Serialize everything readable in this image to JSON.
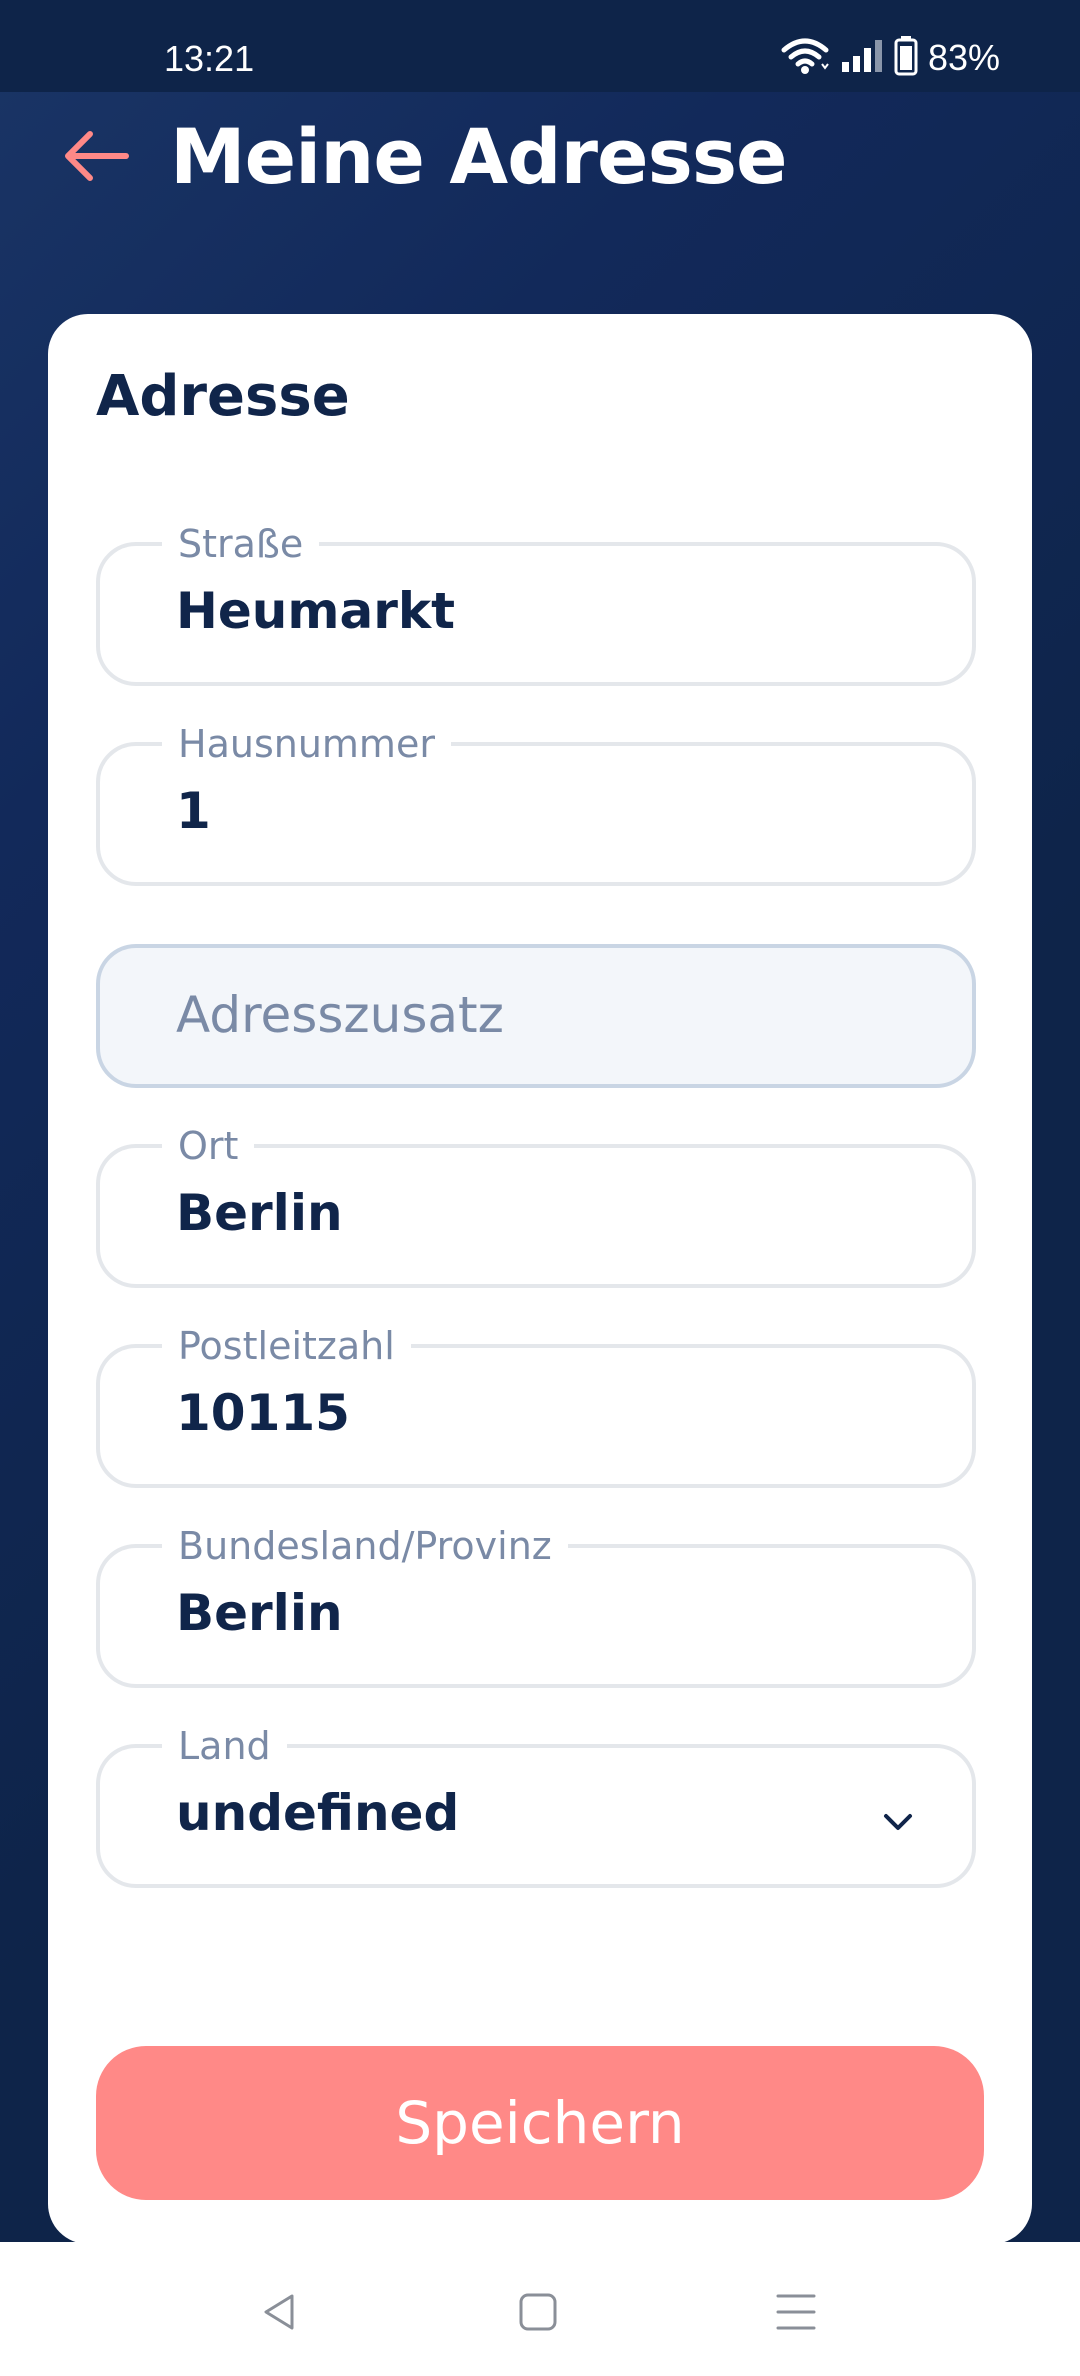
{
  "status_bar": {
    "time": "13:21",
    "battery": "83%"
  },
  "header": {
    "title": "Meine Adresse"
  },
  "form": {
    "section_title": "Adresse",
    "fields": [
      {
        "label": "Straße",
        "value": "Heumarkt"
      },
      {
        "label": "Hausnummer",
        "value": "1"
      },
      {
        "placeholder": "Adresszusatz",
        "value": ""
      },
      {
        "label": "Ort",
        "value": "Berlin"
      },
      {
        "label": "Postleitzahl",
        "value": "10115"
      },
      {
        "label": "Bundesland/Provinz",
        "value": "Berlin"
      },
      {
        "label": "Land",
        "value": "undefined"
      }
    ],
    "save_label": "Speichern"
  },
  "colors": {
    "background": "#0e2449",
    "accent": "#ff8987",
    "text_dark": "#10254a",
    "label": "#7a8aa6"
  },
  "icons": {
    "back": "arrow-left-icon",
    "wifi": "wifi-icon",
    "signal": "signal-icon",
    "battery": "battery-icon",
    "chevron": "chevron-down-icon",
    "nav_back": "nav-back-icon",
    "nav_home": "nav-home-icon",
    "nav_menu": "nav-menu-icon"
  }
}
